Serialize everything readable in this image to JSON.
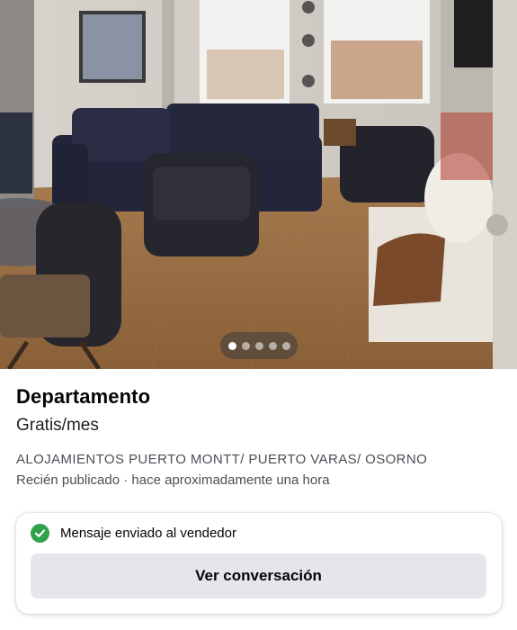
{
  "listing": {
    "photo": {
      "icon": "apartment-living-room-photo",
      "image_count": 5,
      "active_index": 0
    },
    "title": "Departamento",
    "price": "Gratis/mes",
    "location": "ALOJAMIENTOS PUERTO MONTT/ PUERTO VARAS/ OSORNO",
    "posted": "Recién publicado · hace aproximadamente una hora"
  },
  "message": {
    "status_icon": "check-circle-icon",
    "status_color": "#31a24c",
    "status_text": "Mensaje enviado al vendedor",
    "button_label": "Ver conversación"
  }
}
